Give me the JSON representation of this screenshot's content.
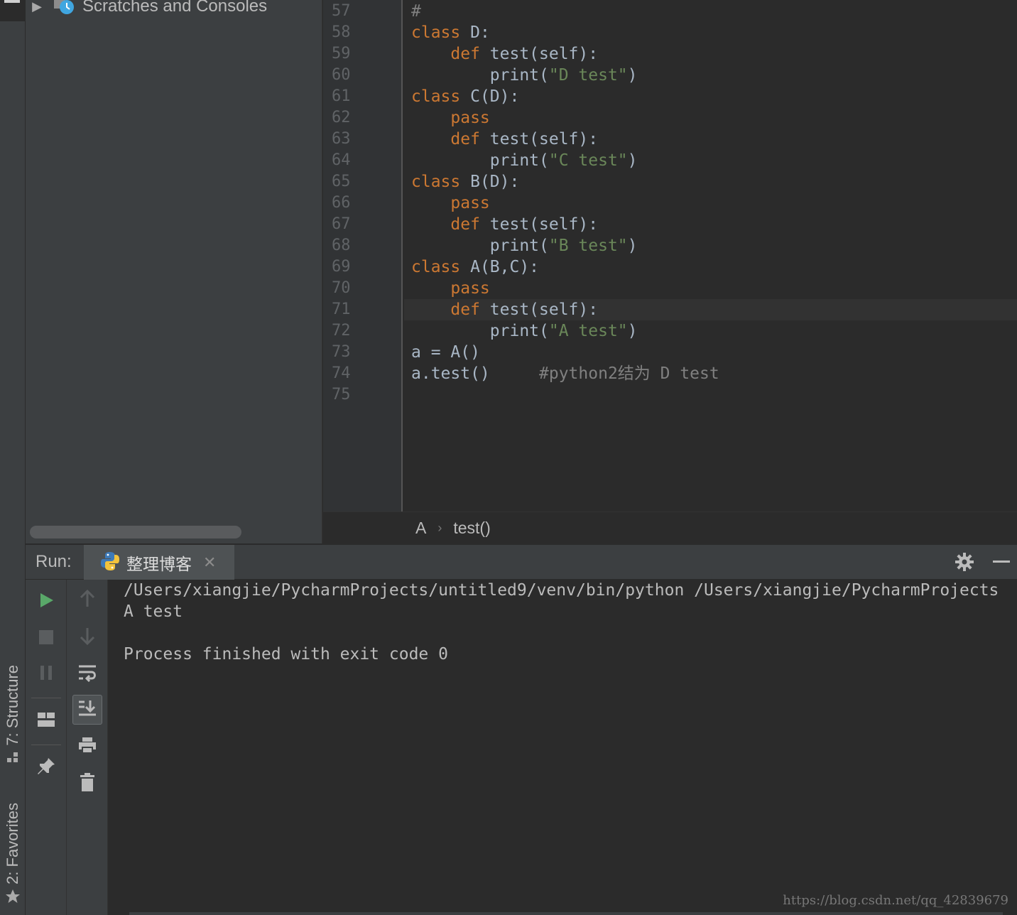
{
  "project": {
    "tree_item": "Scratches and Consoles"
  },
  "side_tabs": {
    "structure": "7: Structure",
    "favorites": "2: Favorites"
  },
  "editor": {
    "lines": [
      {
        "num": "57",
        "code": "#"
      },
      {
        "num": "58",
        "code": "class D:"
      },
      {
        "num": "59",
        "code": "    def test(self):"
      },
      {
        "num": "60",
        "code": "        print(\"D test\")"
      },
      {
        "num": "61",
        "code": "class C(D):"
      },
      {
        "num": "62",
        "code": "    pass"
      },
      {
        "num": "63",
        "code": "    def test(self):"
      },
      {
        "num": "64",
        "code": "        print(\"C test\")"
      },
      {
        "num": "65",
        "code": "class B(D):"
      },
      {
        "num": "66",
        "code": "    pass"
      },
      {
        "num": "67",
        "code": "    def test(self):"
      },
      {
        "num": "68",
        "code": "        print(\"B test\")"
      },
      {
        "num": "69",
        "code": "class A(B,C):"
      },
      {
        "num": "70",
        "code": "    pass"
      },
      {
        "num": "71",
        "code": "    def test(self):"
      },
      {
        "num": "72",
        "code": "        print(\"A test\")"
      },
      {
        "num": "73",
        "code": "a = A()"
      },
      {
        "num": "74",
        "code": "a.test()     #python2结为 D test"
      },
      {
        "num": "75",
        "code": ""
      }
    ],
    "current_line": "71"
  },
  "breadcrumb": {
    "items": [
      "A",
      "test()"
    ]
  },
  "run": {
    "label": "Run:",
    "tab_name": "整理博客"
  },
  "console": {
    "lines": [
      "/Users/xiangjie/PycharmProjects/untitled9/venv/bin/python /Users/xiangjie/PycharmProjects",
      "A test",
      "",
      "Process finished with exit code 0"
    ]
  },
  "watermark": "https://blog.csdn.net/qq_42839679",
  "colors": {
    "keyword": "#cc7832",
    "string": "#6a8759",
    "comment": "#808080",
    "run_green": "#59a869"
  },
  "icons": {
    "run": "play-icon",
    "stop": "stop-icon",
    "pause": "pause-icon",
    "layout": "restore-layout-icon",
    "pin": "pin-icon",
    "up": "up-arrow-icon",
    "down": "down-arrow-icon",
    "wrap": "soft-wrap-icon",
    "scroll_end": "scroll-to-end-icon",
    "print": "print-icon",
    "trash": "trash-icon",
    "gear": "gear-icon",
    "minimize": "minimize-icon"
  }
}
